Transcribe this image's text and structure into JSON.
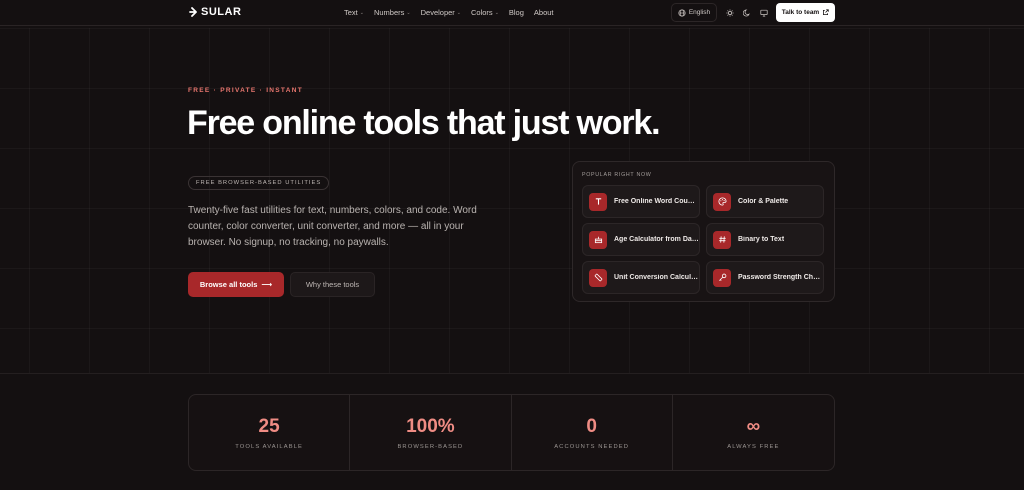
{
  "brand": {
    "name": "SULAR"
  },
  "nav": {
    "links": [
      {
        "label": "Text",
        "has_dropdown": true
      },
      {
        "label": "Numbers",
        "has_dropdown": true
      },
      {
        "label": "Developer",
        "has_dropdown": true
      },
      {
        "label": "Colors",
        "has_dropdown": true
      },
      {
        "label": "Blog",
        "has_dropdown": false
      },
      {
        "label": "About",
        "has_dropdown": false
      }
    ],
    "language": "English",
    "cta": "Talk to team"
  },
  "hero": {
    "eyebrow": "FREE · PRIVATE · INSTANT",
    "title": "Free online tools that just work.",
    "pill": "FREE BROWSER-BASED UTILITIES",
    "description": "Twenty-five fast utilities for text, numbers, colors, and code. Word counter, color converter, unit converter, and more — all in your browser. No signup, no tracking, no paywalls.",
    "primary_button": "Browse all tools",
    "secondary_button": "Why these tools"
  },
  "popular": {
    "title": "POPULAR RIGHT NOW",
    "tools": [
      {
        "label": "Free Online Word Counter",
        "icon": "text-icon"
      },
      {
        "label": "Color & Palette",
        "icon": "palette-icon"
      },
      {
        "label": "Age Calculator from Date of Birth",
        "icon": "cake-icon"
      },
      {
        "label": "Binary to Text",
        "icon": "hash-icon"
      },
      {
        "label": "Unit Conversion Calculator",
        "icon": "ruler-icon"
      },
      {
        "label": "Password Strength Checker",
        "icon": "key-icon"
      }
    ]
  },
  "stats": [
    {
      "value": "25",
      "label": "TOOLS AVAILABLE"
    },
    {
      "value": "100%",
      "label": "BROWSER-BASED"
    },
    {
      "value": "0",
      "label": "ACCOUNTS NEEDED"
    },
    {
      "value": "∞",
      "label": "ALWAYS FREE"
    }
  ],
  "colors": {
    "accent": "#a8282a",
    "accent_text": "#ef8c84",
    "background": "#141011"
  }
}
